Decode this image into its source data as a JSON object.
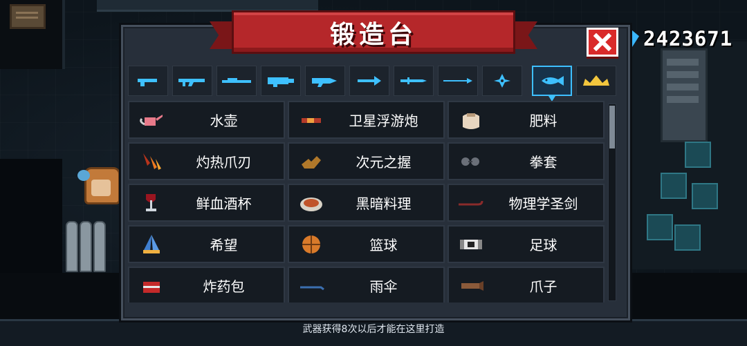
{
  "title": "锻造台",
  "coins": {
    "value": "2423671",
    "icon": "gem-icon"
  },
  "close": {
    "icon": "close-icon"
  },
  "tabs": [
    {
      "icon": "pistol-icon",
      "selected": false
    },
    {
      "icon": "assault-rifle-icon",
      "selected": false
    },
    {
      "icon": "sniper-rifle-icon",
      "selected": false
    },
    {
      "icon": "cannon-icon",
      "selected": false
    },
    {
      "icon": "blaster-icon",
      "selected": false
    },
    {
      "icon": "arrow-icon",
      "selected": false
    },
    {
      "icon": "blade-icon",
      "selected": false
    },
    {
      "icon": "spear-icon",
      "selected": false
    },
    {
      "icon": "shuriken-icon",
      "selected": false
    },
    {
      "icon": "fish-icon",
      "selected": true
    },
    {
      "icon": "crown-icon",
      "selected": false
    }
  ],
  "items": [
    {
      "label": "水壶",
      "icon": "watering-can-icon"
    },
    {
      "label": "卫星浮游炮",
      "icon": "satellite-cannon-icon"
    },
    {
      "label": "肥料",
      "icon": "fertilizer-bag-icon"
    },
    {
      "label": "灼热爪刃",
      "icon": "claw-blade-icon"
    },
    {
      "label": "次元之握",
      "icon": "grip-hand-icon"
    },
    {
      "label": "拳套",
      "icon": "gauntlet-icon"
    },
    {
      "label": "鲜血酒杯",
      "icon": "wine-glass-icon"
    },
    {
      "label": "黑暗料理",
      "icon": "dark-cuisine-icon"
    },
    {
      "label": "物理学圣剑",
      "icon": "crowbar-icon"
    },
    {
      "label": "希望",
      "icon": "praying-hands-icon"
    },
    {
      "label": "篮球",
      "icon": "basketball-icon"
    },
    {
      "label": "足球",
      "icon": "soccer-ball-icon"
    },
    {
      "label": "炸药包",
      "icon": "dynamite-icon"
    },
    {
      "label": "雨伞",
      "icon": "umbrella-icon"
    },
    {
      "label": "爪子",
      "icon": "claw-icon"
    }
  ],
  "hint": "武器获得8次以后才能在这里打造",
  "colors": {
    "accent": "#3ec0ff",
    "banner": "#b5272a",
    "panel": "#272f3a",
    "close": "#d92a2a"
  }
}
